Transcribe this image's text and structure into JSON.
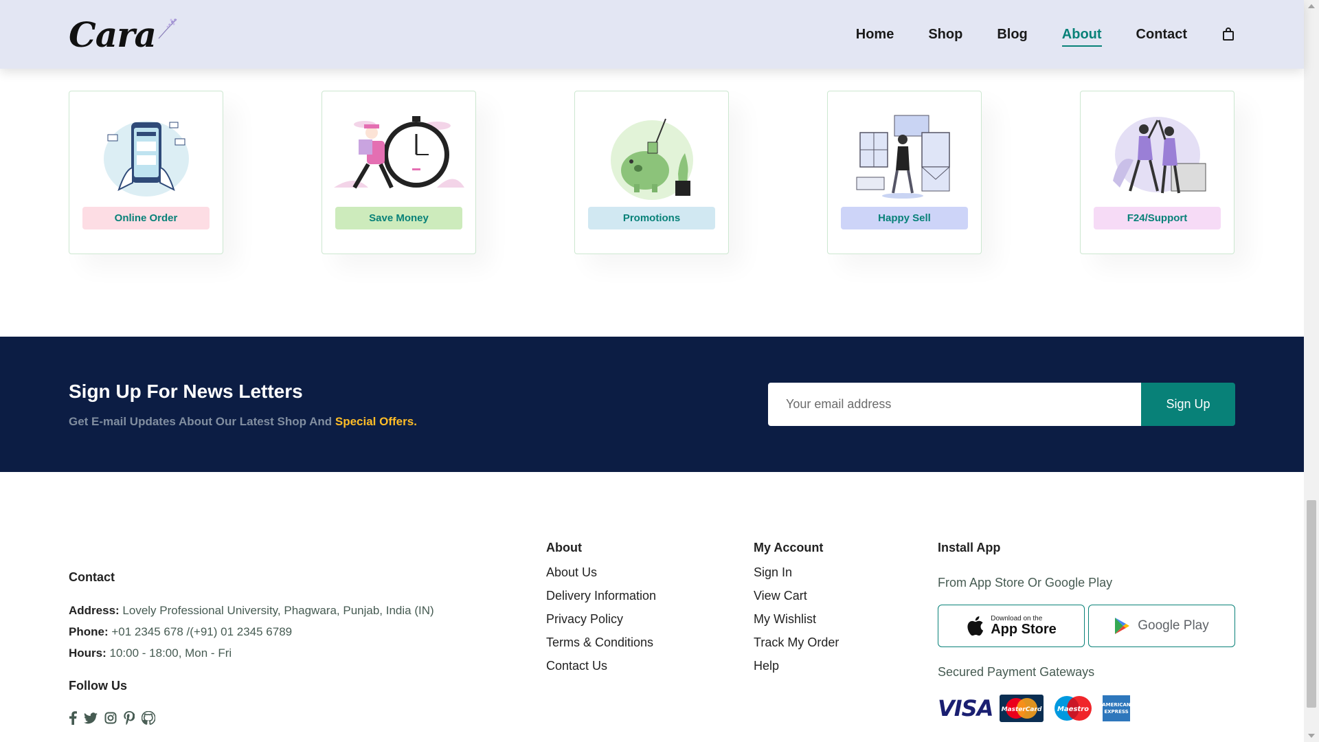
{
  "header": {
    "logo": "Cara",
    "nav": [
      "Home",
      "Shop",
      "Blog",
      "About",
      "Contact"
    ],
    "active": "About",
    "cart_icon": "shopping-bag-icon"
  },
  "features": [
    {
      "label": "Online Order",
      "bg": "#fddde4",
      "icon": "phone-payment-illustration"
    },
    {
      "label": "Save Money",
      "bg": "#cdebbc",
      "icon": "stopwatch-delivery-illustration"
    },
    {
      "label": "Promotions",
      "bg": "#d1e8f2",
      "icon": "piggy-bank-illustration"
    },
    {
      "label": "Happy Sell",
      "bg": "#cdd4f8",
      "icon": "happy-woman-illustration"
    },
    {
      "label": "F24/Support",
      "bg": "#f6dbf6",
      "icon": "support-high-five-illustration"
    }
  ],
  "newsletter": {
    "title": "Sign Up For News Letters",
    "text": "Get E-mail Updates About Our Latest Shop And ",
    "highlight": "Special Offers.",
    "placeholder": "Your email address",
    "button": "Sign Up",
    "accent": "#088178",
    "highlight_color": "#ffbd27",
    "background": "#0c1d44"
  },
  "footer": {
    "contact": {
      "title": "Contact",
      "address_label": "Address:",
      "address": " Lovely Professional University, Phagwara, Punjab, India (IN)",
      "phone_label": "Phone:",
      "phone": " +01 2345 678 /(+91) 01 2345 6789",
      "hours_label": "Hours:",
      "hours": " 10:00 - 18:00, Mon - Fri",
      "follow": "Follow Us",
      "socials": [
        "facebook-icon",
        "twitter-icon",
        "instagram-icon",
        "pinterest-icon",
        "github-icon"
      ]
    },
    "about": {
      "title": "About",
      "links": [
        "About Us",
        "Delivery Information",
        "Privacy Policy",
        "Terms & Conditions",
        "Contact Us"
      ]
    },
    "account": {
      "title": "My Account",
      "links": [
        "Sign In",
        "View Cart",
        "My Wishlist",
        "Track My Order",
        "Help"
      ]
    },
    "install": {
      "title": "Install App",
      "subtitle": "From App Store Or Google Play",
      "appstore_small": "Download on the",
      "appstore_big": "App Store",
      "googleplay": "Google Play",
      "gateways": "Secured Payment Gateways",
      "payments": [
        "VISA",
        "MasterCard",
        "Maestro",
        "AMERICAN EXPRESS"
      ]
    }
  }
}
